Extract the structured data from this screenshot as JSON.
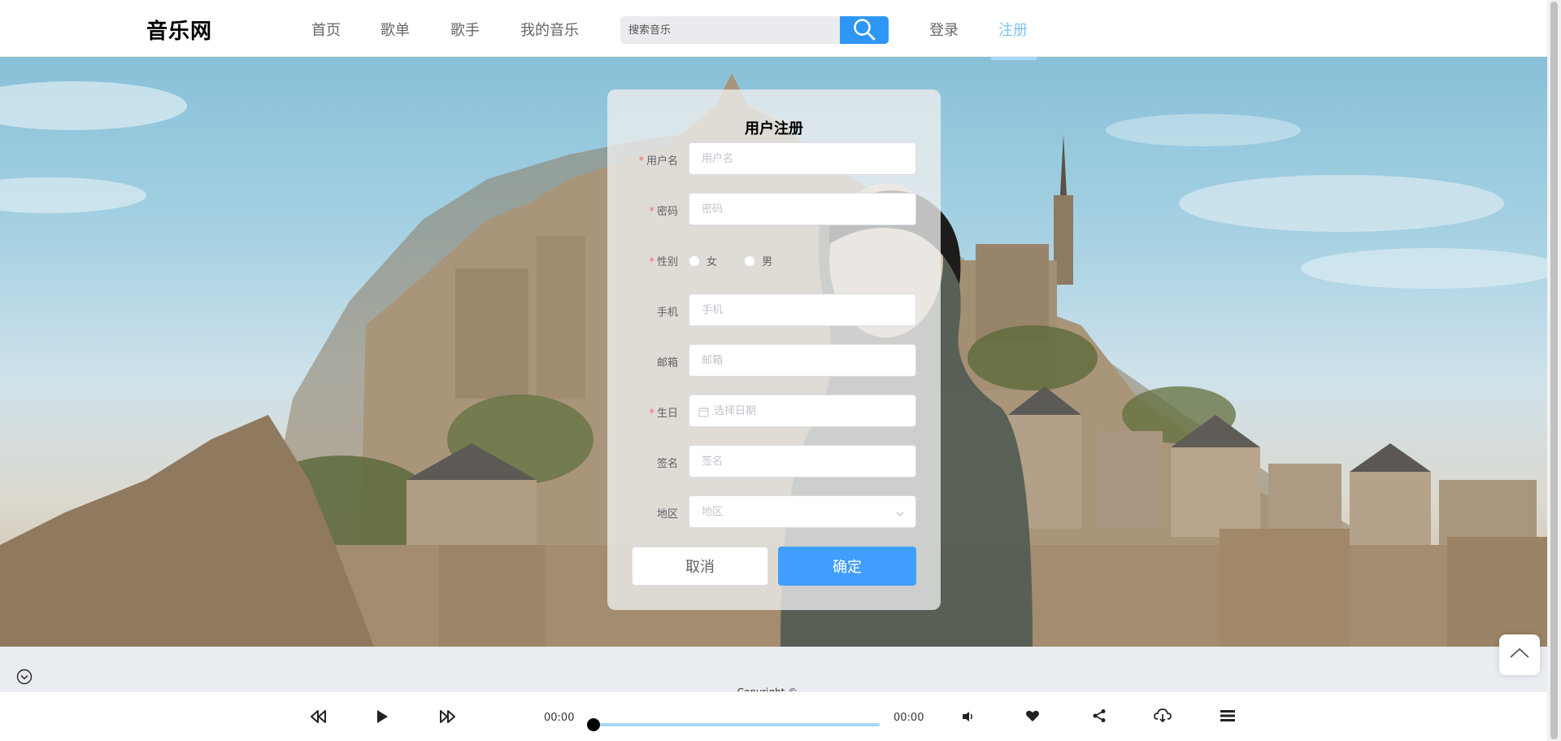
{
  "header": {
    "logo": "音乐网",
    "nav": [
      "首页",
      "歌单",
      "歌手",
      "我的音乐"
    ],
    "search_placeholder": "搜索音乐",
    "login": "登录",
    "register": "注册",
    "active_tab": "注册"
  },
  "form": {
    "title": "用户注册",
    "username": {
      "label": "用户名",
      "placeholder": "用户名",
      "required": true
    },
    "password": {
      "label": "密码",
      "placeholder": "密码",
      "required": true
    },
    "gender": {
      "label": "性别",
      "required": true,
      "options": [
        "女",
        "男"
      ]
    },
    "phone": {
      "label": "手机",
      "placeholder": "手机"
    },
    "email": {
      "label": "邮箱",
      "placeholder": "邮箱"
    },
    "birthday": {
      "label": "生日",
      "placeholder": "选择日期",
      "required": true
    },
    "signature": {
      "label": "签名",
      "placeholder": "签名"
    },
    "region": {
      "label": "地区",
      "placeholder": "地区"
    },
    "cancel": "取消",
    "confirm": "确定",
    "required_mark": "*"
  },
  "player": {
    "current_time": "00:00",
    "total_time": "00:00",
    "progress": 0
  },
  "footer": {
    "copyright": "Copyright © ..."
  },
  "icons": {
    "search": "search-icon",
    "rewind": "rewind-icon",
    "play": "play-icon",
    "forward": "forward-icon",
    "volume": "volume-icon",
    "like": "heart-icon",
    "share": "share-icon",
    "download": "download-icon",
    "playlist": "playlist-icon",
    "back_top": "chevron-up-icon",
    "collapse": "chevron-down-icon"
  },
  "colors": {
    "accent": "#409eff",
    "active_nav": "#7cc4f2",
    "search_button": "#2e97f5",
    "progress_track": "#a6d7f6"
  }
}
